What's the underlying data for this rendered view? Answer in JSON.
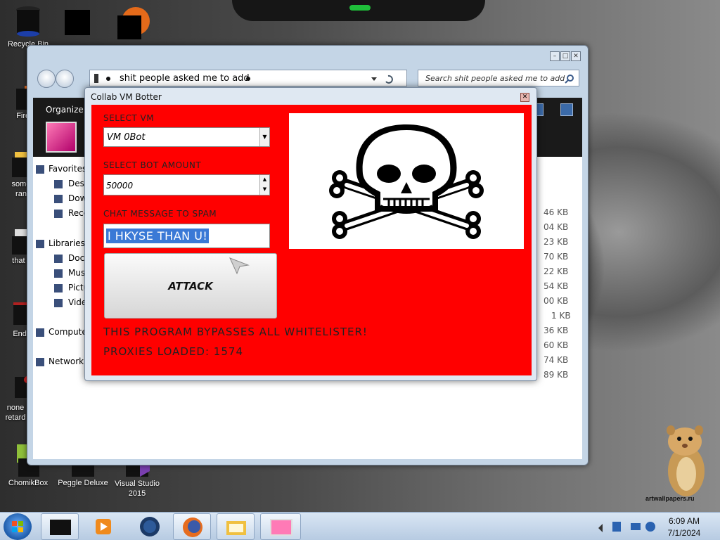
{
  "desktop": {
    "icons": [
      {
        "label": "Recycle Bin",
        "icon": "recycle-bin-icon"
      },
      {
        "label": "Firefox",
        "icon": "firefox-icon"
      },
      {
        "label": "some ran",
        "icon": "folder-icon"
      },
      {
        "label": "that bu",
        "icon": "file-icon"
      },
      {
        "label": "Ender",
        "icon": "app-icon"
      },
      {
        "label": "none retard",
        "icon": "file-icon"
      },
      {
        "label": "ChomikBox",
        "icon": "chomikbox-icon"
      },
      {
        "label": "Peggle Deluxe",
        "icon": "peggle-icon"
      },
      {
        "label": "Visual Studio 2015",
        "icon": "visual-studio-icon"
      }
    ]
  },
  "explorer": {
    "address": "shit people asked me to add",
    "search_placeholder": "Search shit people asked me to add",
    "toolbar": {
      "organize": "Organize"
    },
    "nav": [
      {
        "label": "Favorites"
      },
      {
        "label": "Desktop"
      },
      {
        "label": "Downloads"
      },
      {
        "label": "Recent"
      },
      {
        "label": "Libraries"
      },
      {
        "label": "Documents"
      },
      {
        "label": "Music"
      },
      {
        "label": "Pictures"
      },
      {
        "label": "Videos"
      },
      {
        "label": "Computer"
      },
      {
        "label": "Network"
      }
    ],
    "sizes": [
      "46 KB",
      "04 KB",
      "23 KB",
      "70 KB",
      "22 KB",
      "54 KB",
      "00 KB",
      "1 KB",
      "36 KB",
      "60 KB",
      "74 KB",
      "89 KB"
    ]
  },
  "collab": {
    "title": "Collab VM Botter",
    "select_vm_label": "SELECT VM",
    "select_vm_value": "VM 0Bot",
    "bot_amount_label": "SELECT BOT AMOUNT",
    "bot_amount_value": "50000",
    "chat_label": "CHAT MESSAGE TO SPAM",
    "chat_value": "I HKYSE THAN U!",
    "attack_label": "ATTACK",
    "bypass_text": "THIS PROGRAM BYPASSES ALL WHITELISTER!",
    "proxies_text": "PROXIES LOADED: 1574",
    "image": "skull-and-crossbones-icon",
    "panel_color": "#ff0000"
  },
  "watermark": "artwallpapers.ru",
  "taskbar": {
    "apps": [
      "media-device-icon",
      "media-player-icon",
      "globe-icon",
      "firefox-icon",
      "explorer-icon",
      "collab-vm-botter-icon"
    ],
    "time": "6:09 AM",
    "date": "7/1/2024"
  }
}
